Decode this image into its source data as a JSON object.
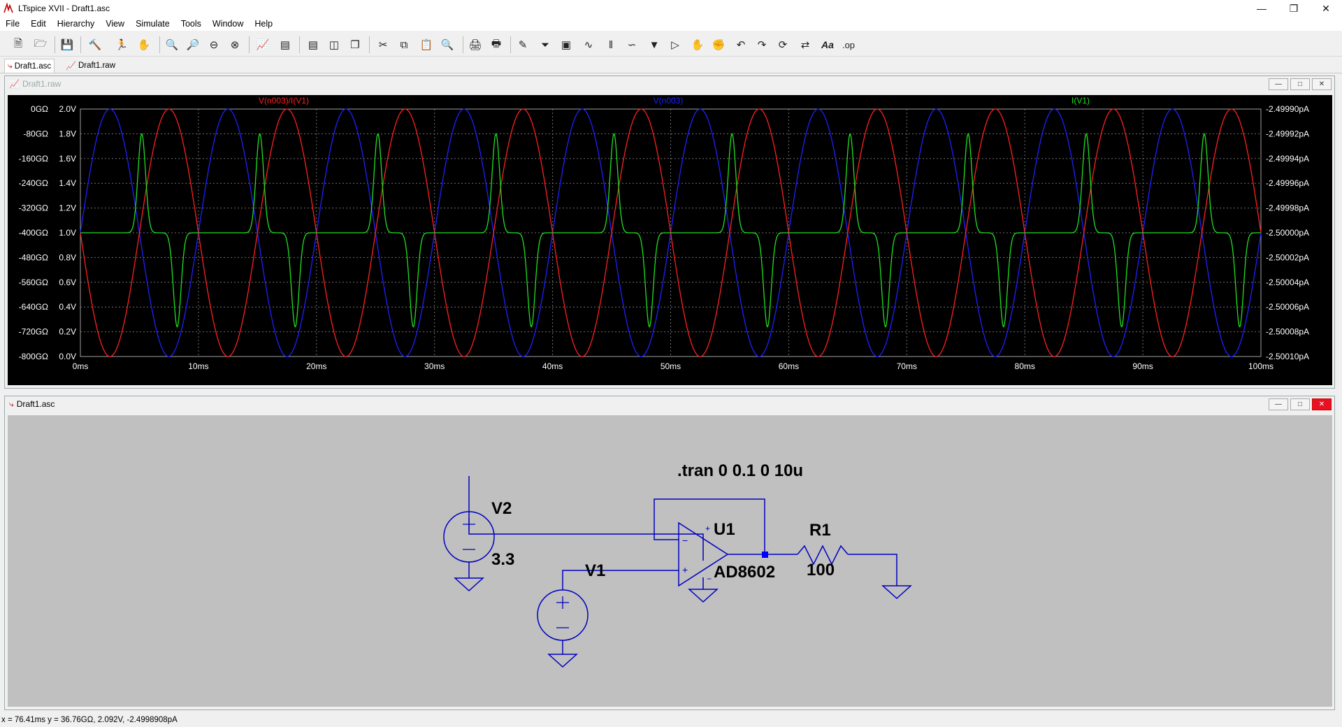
{
  "window": {
    "title": "LTspice XVII - Draft1.asc"
  },
  "menu": [
    "File",
    "Edit",
    "Hierarchy",
    "View",
    "Simulate",
    "Tools",
    "Window",
    "Help"
  ],
  "toolbar": {
    "icons": [
      "new-schematic",
      "open",
      "save",
      "control-panel",
      "run",
      "halt",
      "zoom-in",
      "zoom-pan",
      "zoom-out",
      "zoom-fit",
      "autorange",
      "visible-traces",
      "tile-horizontal",
      "tile-vertical",
      "cascade",
      "cut",
      "copy",
      "paste",
      "find",
      "print",
      "print-setup",
      "draw-wire",
      "ground",
      "label-net",
      "resistor",
      "capacitor",
      "inductor",
      "diode",
      "component",
      "move",
      "drag",
      "undo",
      "redo",
      "rotate",
      "mirror",
      "text",
      "spice-directive"
    ],
    "text_label": "Aa",
    "op_label": ".op"
  },
  "tabs": [
    {
      "label": "Draft1.asc",
      "icon": "schematic-tab-icon",
      "active": true
    },
    {
      "label": "Draft1.raw",
      "icon": "waveform-tab-icon",
      "active": false
    }
  ],
  "waveform_window": {
    "title": "Draft1.raw",
    "traces": [
      {
        "label": "V(n003)/I(V1)",
        "color": "#ff2020"
      },
      {
        "label": "V(n003)",
        "color": "#2020ff"
      },
      {
        "label": "I(V1)",
        "color": "#20e020"
      }
    ],
    "y_left_ticks": [
      "0GΩ",
      "-80GΩ",
      "-160GΩ",
      "-240GΩ",
      "-320GΩ",
      "-400GΩ",
      "-480GΩ",
      "-560GΩ",
      "-640GΩ",
      "-720GΩ",
      "-800GΩ"
    ],
    "y_mid_ticks": [
      "2.0V",
      "1.8V",
      "1.6V",
      "1.4V",
      "1.2V",
      "1.0V",
      "0.8V",
      "0.6V",
      "0.4V",
      "0.2V",
      "0.0V"
    ],
    "y_right_ticks": [
      "-2.49990pA",
      "-2.49992pA",
      "-2.49994pA",
      "-2.49996pA",
      "-2.49998pA",
      "-2.50000pA",
      "-2.50002pA",
      "-2.50004pA",
      "-2.50006pA",
      "-2.50008pA",
      "-2.50010pA"
    ],
    "x_ticks": [
      "0ms",
      "10ms",
      "20ms",
      "30ms",
      "40ms",
      "50ms",
      "60ms",
      "70ms",
      "80ms",
      "90ms",
      "100ms"
    ]
  },
  "chart_data": {
    "type": "line",
    "title": "",
    "xlabel": "",
    "ylabel": "",
    "x_unit": "ms",
    "xlim": [
      0,
      100
    ],
    "series": [
      {
        "name": "V(n003)",
        "axis": "V",
        "ylim": [
          0.0,
          2.0
        ],
        "kind": "sine",
        "frequency_hz": 100,
        "offset": 1.0,
        "amplitude": 1.0,
        "phase_deg": 0
      },
      {
        "name": "V(n003)/I(V1)",
        "axis": "GΩ",
        "ylim": [
          -800,
          0
        ],
        "kind": "sine",
        "frequency_hz": 100,
        "offset": -400,
        "amplitude": 400,
        "phase_deg": 180
      },
      {
        "name": "I(V1)",
        "axis": "pA",
        "ylim": [
          -2.5001,
          -2.4999
        ],
        "kind": "pulse",
        "period_ms": 10,
        "baseline": -2.5,
        "peak": -2.49992,
        "trough": -2.500076
      }
    ]
  },
  "schematic_window": {
    "title": "Draft1.asc",
    "directive": ".tran 0 0.1 0 10u",
    "components": {
      "v2_name": "V2",
      "v2_value": "3.3",
      "v1_name": "V1",
      "u1_name": "U1",
      "u1_value": "AD8602",
      "r1_name": "R1",
      "r1_value": "100"
    },
    "pin_plus": "+",
    "pin_minus": "−"
  },
  "status": {
    "text": "x = 76.41ms    y = 36.76GΩ, 2.092V, -2.4998908pA"
  },
  "colors": {
    "wire": "#0000c0",
    "plot_bg": "#000000",
    "schematic_bg": "#c0c0c0",
    "grid": "#707070"
  }
}
